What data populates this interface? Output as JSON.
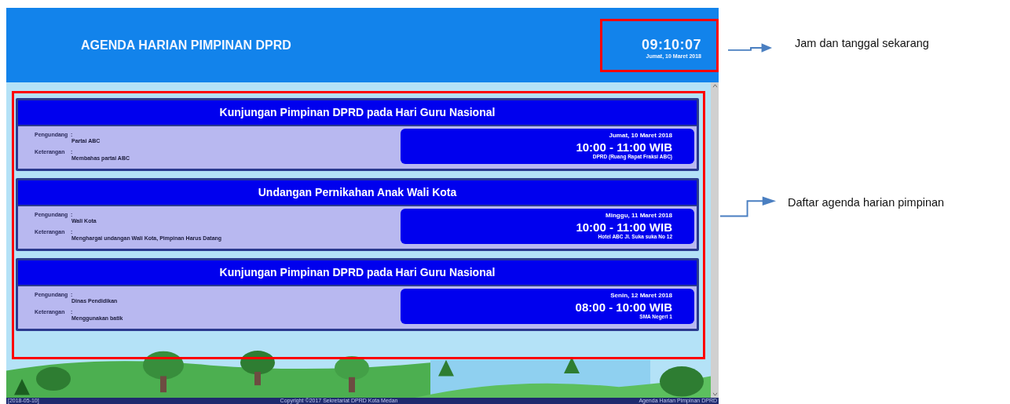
{
  "header": {
    "title": "AGENDA HARIAN PIMPINAN DPRD",
    "clock": {
      "time": "09:10:07",
      "date": "Jumat, 10 Maret 2018"
    }
  },
  "agenda": [
    {
      "title": "Kunjungan Pimpinan DPRD pada Hari Guru Nasional",
      "fields": [
        {
          "label": "Pengundang",
          "separator": ":",
          "value": "Partai ABC"
        },
        {
          "label": "Keterangan",
          "separator": ":",
          "value": "Membahas partai ABC"
        }
      ],
      "date": "Jumat, 10 Maret 2018",
      "time": "10:00 - 11:00 WIB",
      "place": "DPRD (Ruang Rapat Fraksi ABC)"
    },
    {
      "title": "Undangan Pernikahan Anak Wali Kota",
      "fields": [
        {
          "label": "Pengundang",
          "separator": ":",
          "value": "Wali Kota"
        },
        {
          "label": "Keterangan",
          "separator": ":",
          "value": "Menghargai undangan Wali Kota, Pimpinan Harus Datang"
        }
      ],
      "date": "Minggu, 11 Maret 2018",
      "time": "10:00 - 11:00 WIB",
      "place": "Hotel ABC Jl. Suka suka No 12"
    },
    {
      "title": "Kunjungan Pimpinan DPRD pada Hari Guru Nasional",
      "fields": [
        {
          "label": "Pengundang",
          "separator": ":",
          "value": "Dinas Pendidikan"
        },
        {
          "label": "Keterangan",
          "separator": ":",
          "value": "Menggunakan batik"
        }
      ],
      "date": "Senin, 12 Maret 2018",
      "time": "08:00 - 10:00 WIB",
      "place": "SMA Negeri 1"
    }
  ],
  "footer": {
    "date": "[2018-05-10]",
    "copyright": "Copyright ©2017 Sekretariat DPRD Kota Medan",
    "app_name": "Agenda Harian Pimpinan DPRD"
  },
  "annotations": {
    "clock_callout": "Jam dan tanggal sekarang",
    "agenda_callout": "Daftar agenda harian pimpinan"
  }
}
